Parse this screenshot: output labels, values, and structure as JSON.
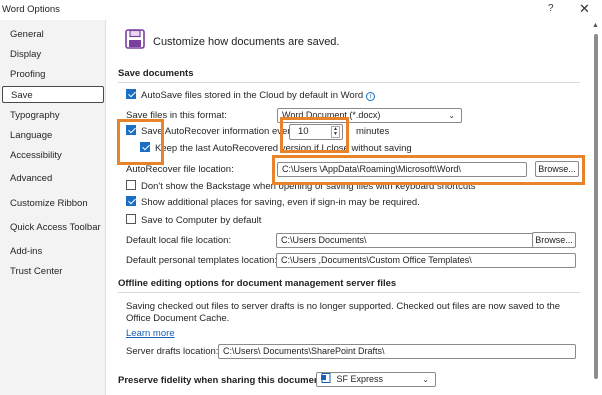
{
  "window": {
    "title": "Word Options",
    "help": "?",
    "close": "✕"
  },
  "sidebar": {
    "items": [
      {
        "label": "General"
      },
      {
        "label": "Display"
      },
      {
        "label": "Proofing"
      },
      {
        "label": "Save",
        "active": true
      },
      {
        "label": "Typography"
      },
      {
        "label": "Language"
      },
      {
        "label": "Accessibility"
      },
      {
        "label": "Advanced"
      },
      {
        "label": "Customize Ribbon"
      },
      {
        "label": "Quick Access Toolbar"
      },
      {
        "label": "Add-ins"
      },
      {
        "label": "Trust Center"
      }
    ]
  },
  "header": {
    "title": "Customize how documents are saved."
  },
  "save_documents": {
    "section": "Save documents",
    "autosave_label": "AutoSave files stored in the Cloud by default in Word",
    "format_label": "Save files in this format:",
    "format_value": "Word Document (*.docx)",
    "autorecover_label": "Save AutoRecover information every",
    "autorecover_minutes": "10",
    "minutes_label": "minutes",
    "keep_last_label": "Keep the last AutoRecovered version if I close without saving",
    "autorecover_location_label": "AutoRecover file location:",
    "autorecover_location_value": "C:\\Users             \\AppData\\Roaming\\Microsoft\\Word\\",
    "browse1": "Browse...",
    "backstage_label": "Don't show the Backstage when opening or saving files with keyboard shortcuts",
    "additional_places_label": "Show additional places for saving, even if sign-in may be required.",
    "save_computer_label": "Save to Computer by default",
    "default_local_label": "Default local file location:",
    "default_local_value": "C:\\Users                          Documents\\",
    "browse2": "Browse...",
    "templates_label": "Default personal templates location:",
    "templates_value": "C:\\Users                       ,Documents\\Custom Office Templates\\"
  },
  "offline": {
    "section": "Offline editing options for document management server files",
    "description": "Saving checked out files to server drafts is no longer supported. Checked out files are now saved to the Office Document Cache.",
    "learn_more": "Learn more",
    "drafts_label": "Server drafts location:",
    "drafts_value": "C:\\Users\\               Documents\\SharePoint Drafts\\"
  },
  "fidelity": {
    "label": "Preserve fidelity when sharing this document:",
    "doc_value": "SF Express"
  },
  "checkbox_states": {
    "autosave": true,
    "autorecover": true,
    "keep_last": true,
    "backstage": false,
    "additional_places": true,
    "save_computer": false
  },
  "colors": {
    "accent": "#1a6fc4",
    "highlight": "#e8832a"
  }
}
